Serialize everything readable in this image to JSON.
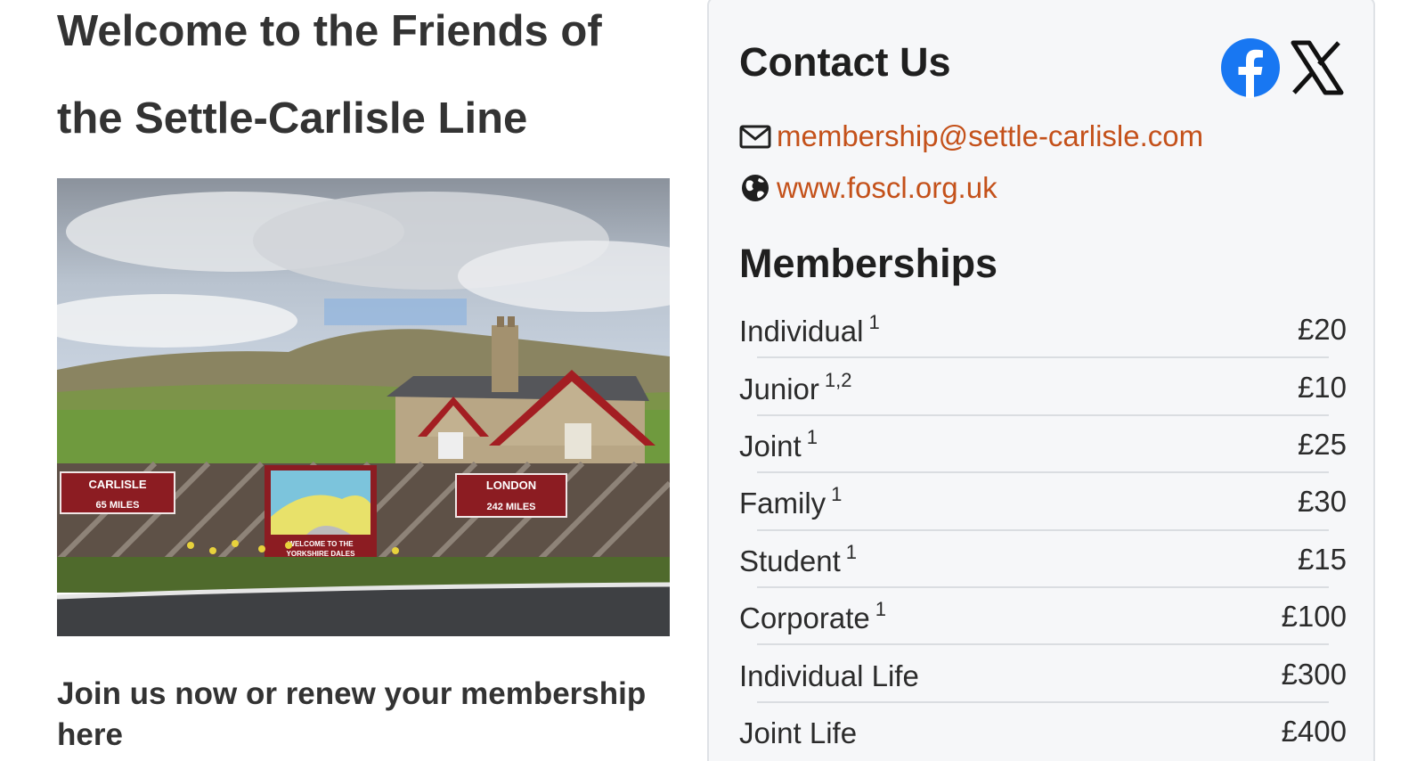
{
  "welcome": {
    "title_line1": "Welcome to the Friends of",
    "title_line2": "the Settle-Carlisle Line"
  },
  "hero_image": {
    "signs": {
      "left_line1": "CARLISLE",
      "left_line2": "65 MILES",
      "right_line1": "LONDON",
      "right_line2": "242 MILES",
      "board_line1": "WELCOME TO THE",
      "board_line2": "YORKSHIRE DALES"
    }
  },
  "join": {
    "text": "Join us now or renew your membership here"
  },
  "contact": {
    "title": "Contact Us",
    "email": "membership@settle-carlisle.com",
    "website": "www.foscl.org.uk",
    "social_icons": [
      "facebook-icon",
      "x-icon"
    ],
    "link_color": "#c4511a",
    "facebook_color": "#1877f2"
  },
  "memberships": {
    "title": "Memberships",
    "rows": [
      {
        "name": "Individual",
        "note": "1",
        "price": "£20"
      },
      {
        "name": "Junior",
        "note": "1,2",
        "price": "£10"
      },
      {
        "name": "Joint",
        "note": "1",
        "price": "£25"
      },
      {
        "name": "Family",
        "note": "1",
        "price": "£30"
      },
      {
        "name": "Student",
        "note": "1",
        "price": "£15"
      },
      {
        "name": "Corporate",
        "note": "1",
        "price": "£100"
      },
      {
        "name": "Individual Life",
        "note": "",
        "price": "£300"
      },
      {
        "name": "Joint Life",
        "note": "",
        "price": "£400"
      }
    ]
  }
}
